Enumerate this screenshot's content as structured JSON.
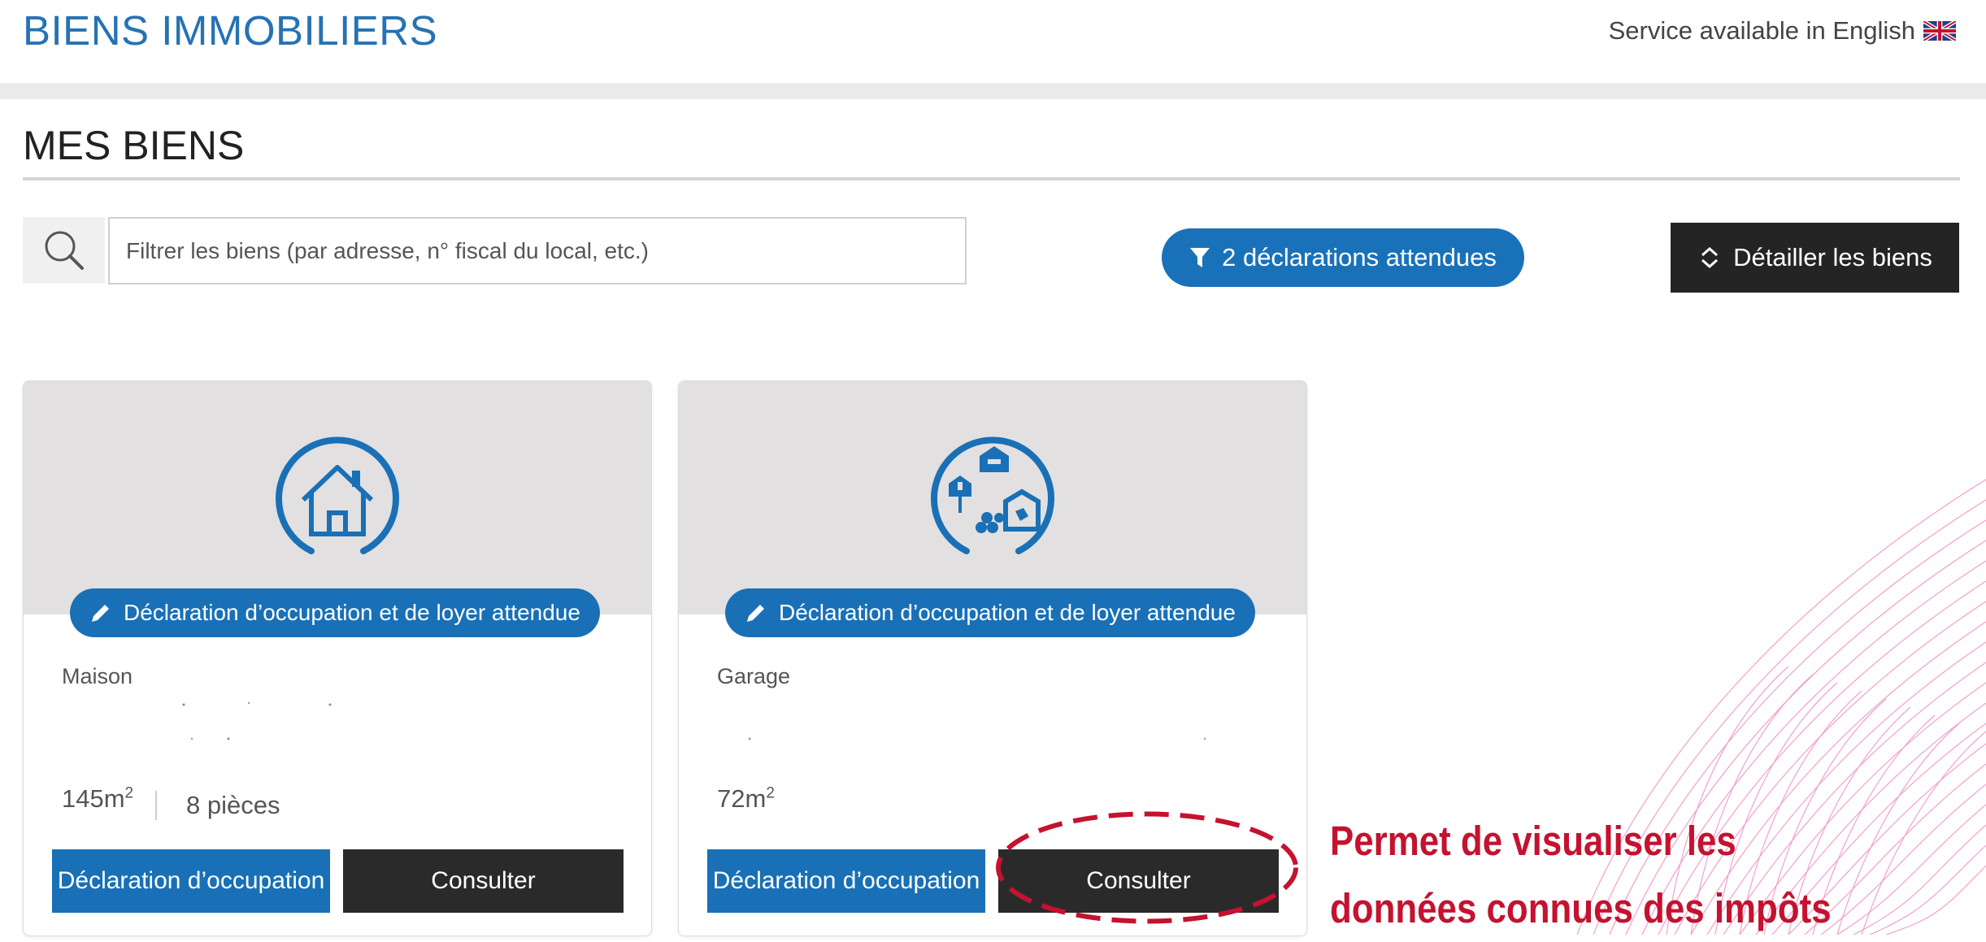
{
  "header": {
    "title": "BIENS IMMOBILIERS",
    "language_link": "Service available in English"
  },
  "section": {
    "title": "MES BIENS"
  },
  "search": {
    "placeholder": "Filtrer les biens (par adresse, n° fiscal du local, etc.)"
  },
  "filter": {
    "label": "2 déclarations attendues"
  },
  "detail_button": {
    "label": "Détailler les biens"
  },
  "properties": [
    {
      "badge": "Déclaration d’occupation et de loyer attendue",
      "type": "Maison",
      "surface": "145m",
      "surface_exp": "2",
      "rooms": "8 pièces",
      "declare_label": "Déclaration d’occupation",
      "consult_label": "Consulter"
    },
    {
      "badge": "Déclaration d’occupation et de loyer attendue",
      "type": "Garage",
      "surface": "72m",
      "surface_exp": "2",
      "declare_label": "Déclaration d’occupation",
      "consult_label": "Consulter"
    }
  ],
  "annotation": {
    "line1": "Permet de visualiser les",
    "line2": "données connues des impôts",
    "color": "#c4122f"
  },
  "colors": {
    "brand_blue": "#1970b6",
    "dark_button": "#242424"
  }
}
